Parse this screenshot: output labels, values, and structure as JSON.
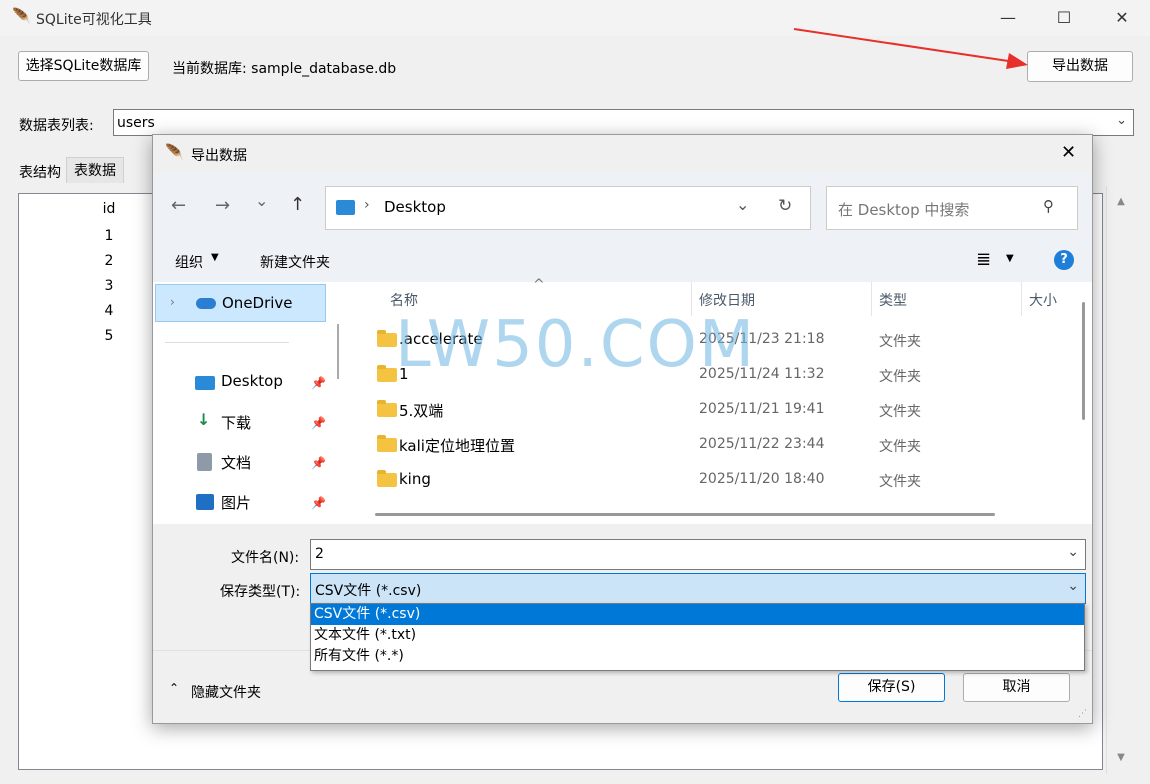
{
  "app": {
    "title": "SQLite可视化工具",
    "select_db_button": "选择SQLite数据库",
    "current_db_label": "当前数据库: sample_database.db",
    "export_button": "导出数据",
    "table_list_label": "数据表列表:",
    "table_selected": "users",
    "tabs": [
      "表结构",
      "表数据"
    ],
    "column_header": "id",
    "ids": [
      "1",
      "2",
      "3",
      "4",
      "5"
    ]
  },
  "window_controls": {
    "minimize": "—",
    "maximize": "☐",
    "close": "✕"
  },
  "dialog": {
    "title": "导出数据",
    "close": "✕",
    "nav": {
      "back": "←",
      "forward": "→",
      "history": "⌄",
      "up": "↑",
      "refresh": "↻",
      "dropdown": "⌄"
    },
    "path_segment": "Desktop",
    "search_placeholder": "在 Desktop 中搜索",
    "organize": "组织",
    "new_folder": "新建文件夹",
    "help": "?",
    "tree": {
      "onedrive": "OneDrive",
      "items": [
        "Desktop",
        "下载",
        "文档",
        "图片"
      ]
    },
    "columns": {
      "name": "名称",
      "modified": "修改日期",
      "type": "类型",
      "size": "大小"
    },
    "files": [
      {
        "name": ".accelerate",
        "date": "2025/11/23 21:18",
        "type": "文件夹"
      },
      {
        "name": "1",
        "date": "2025/11/24 11:32",
        "type": "文件夹"
      },
      {
        "name": "5.双端",
        "date": "2025/11/21 19:41",
        "type": "文件夹"
      },
      {
        "name": "kali定位地理位置",
        "date": "2025/11/22 23:44",
        "type": "文件夹"
      },
      {
        "name": "king",
        "date": "2025/11/20 18:40",
        "type": "文件夹"
      }
    ],
    "filename_label": "文件名(N):",
    "filename_value": "2",
    "savetype_label": "保存类型(T):",
    "savetype_value": "CSV文件 (*.csv)",
    "savetype_options": [
      "CSV文件 (*.csv)",
      "文本文件 (*.txt)",
      "所有文件 (*.*)"
    ],
    "hide_folders": "隐藏文件夹",
    "save_button": "保存(S)",
    "cancel_button": "取消"
  },
  "watermark": "LW50.COM",
  "colors": {
    "selection": "#0078d7",
    "accent_red": "#e8302a",
    "folder": "#f5c342"
  }
}
